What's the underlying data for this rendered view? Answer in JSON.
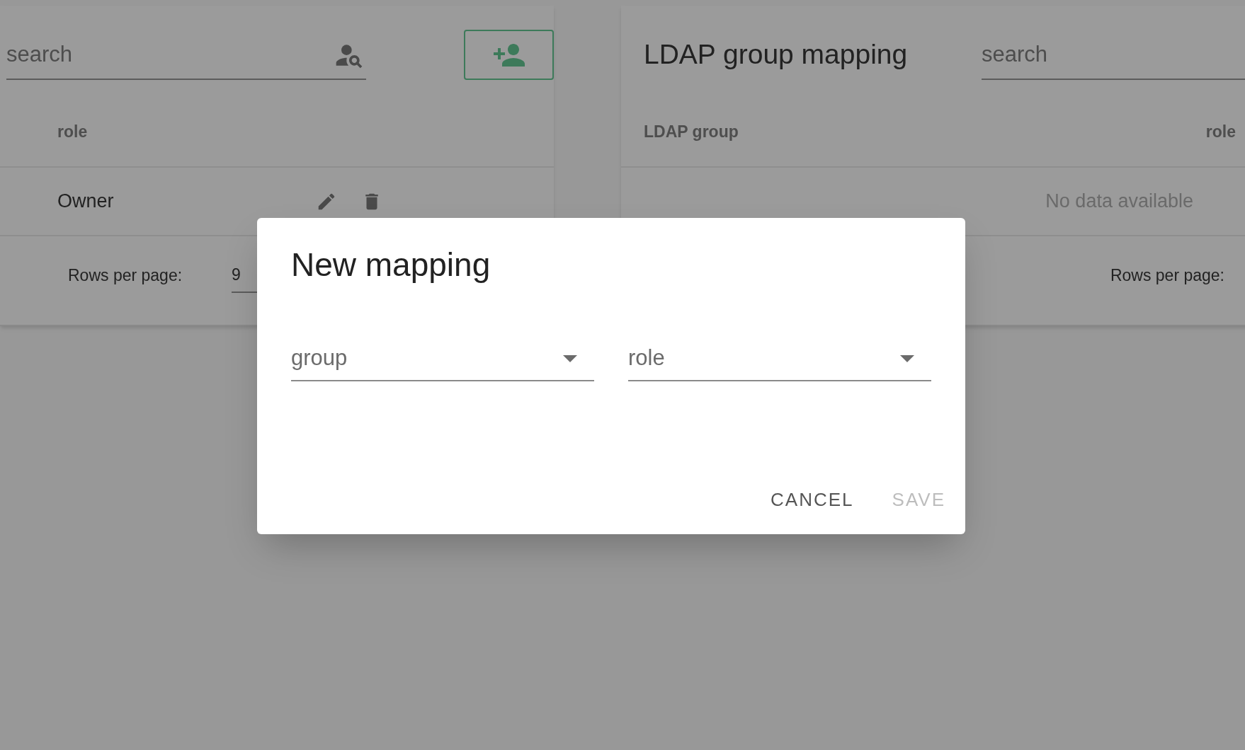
{
  "users_panel": {
    "search": {
      "placeholder": "search"
    },
    "columns": [
      "role"
    ],
    "rows": [
      {
        "role": "Owner"
      }
    ],
    "footer": {
      "rows_per_page_label": "Rows per page:",
      "rows_per_page_value": "9"
    }
  },
  "ldap_panel": {
    "title": "LDAP group mapping",
    "search": {
      "placeholder": "search"
    },
    "columns": [
      "LDAP group",
      "role"
    ],
    "empty_text": "No data available",
    "footer": {
      "rows_per_page_label": "Rows per page:"
    }
  },
  "dialog": {
    "title": "New mapping",
    "fields": [
      {
        "placeholder": "group"
      },
      {
        "placeholder": "role"
      }
    ],
    "buttons": [
      {
        "label": "CANCEL",
        "disabled": false
      },
      {
        "label": "SAVE",
        "disabled": true
      }
    ]
  }
}
